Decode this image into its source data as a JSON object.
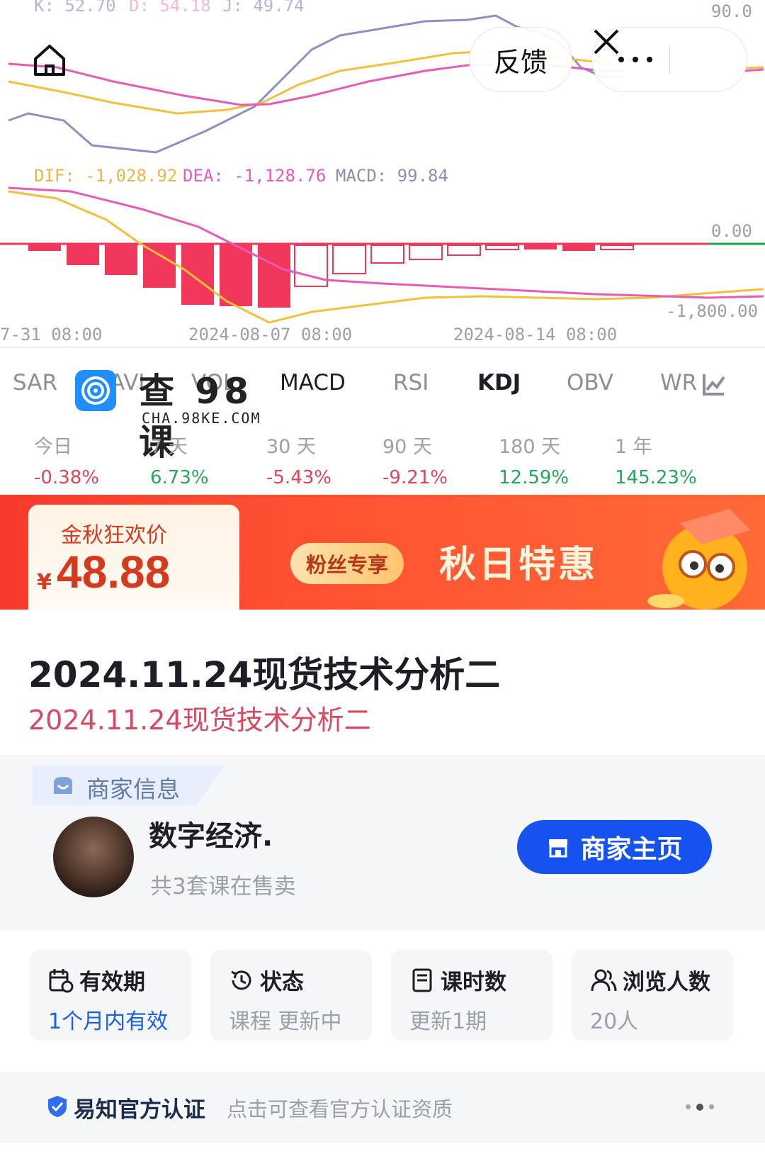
{
  "chart": {
    "kdj_legend": {
      "k": "K: 52.70",
      "d": "D: 54.18",
      "j": "J: 49.74"
    },
    "kdj_axis_top": "90.0",
    "macd_legend": {
      "dif": "DIF: -1,028.92",
      "dea": "DEA: -1,128.76",
      "macd": "MACD: 99.84"
    },
    "macd_axis_zero": "0.00",
    "macd_axis_low": "-1,800.00",
    "x_labels": [
      "7-31 08:00",
      "2024-08-07 08:00",
      "2024-08-14 08:00"
    ],
    "colors": {
      "k": "#8f8fc4",
      "d": "#f0c23a",
      "j": "#e85ab9",
      "up": "#f2385a",
      "down": "#16a34a"
    }
  },
  "header": {
    "feedback_label": "反馈"
  },
  "tabs": [
    "SAR",
    "AVL",
    "VOL",
    "MACD",
    "RSI",
    "KDJ",
    "OBV",
    "WR"
  ],
  "tabs_active": "KDJ",
  "watermark": {
    "title": "查 98 课",
    "url": "CHA.98KE.COM"
  },
  "performance": [
    {
      "label": "今日",
      "value": "-0.38%",
      "trend": "down"
    },
    {
      "label": "7 天",
      "value": "6.73%",
      "trend": "up"
    },
    {
      "label": "30 天",
      "value": "-5.43%",
      "trend": "down"
    },
    {
      "label": "90 天",
      "value": "-9.21%",
      "trend": "down"
    },
    {
      "label": "180 天",
      "value": "12.59%",
      "trend": "up"
    },
    {
      "label": "1 年",
      "value": "145.23%",
      "trend": "up"
    }
  ],
  "banner": {
    "promo_tag": "金秋狂欢价",
    "currency": "¥",
    "price": "48.88",
    "fan_pill": "粉丝专享",
    "headline": "秋日特惠"
  },
  "course": {
    "title": "2024.11.24现货技术分析二",
    "subtitle": "2024.11.24现货技术分析二"
  },
  "merchant": {
    "section_label": "商家信息",
    "name": "数字经济.",
    "courses_on_sale": "共3套课在售卖",
    "home_button": "商家主页"
  },
  "info_cards": [
    {
      "label": "有效期",
      "value": "1个月内有效",
      "icon": "calendar-clock-icon"
    },
    {
      "label": "状态",
      "value": "课程 更新中",
      "icon": "history-icon"
    },
    {
      "label": "课时数",
      "value": "更新1期",
      "icon": "document-icon"
    },
    {
      "label": "浏览人数",
      "value": "20人",
      "icon": "users-icon"
    }
  ],
  "certification": {
    "name": "易知官方认证",
    "description": "点击可查看官方认证资质"
  }
}
